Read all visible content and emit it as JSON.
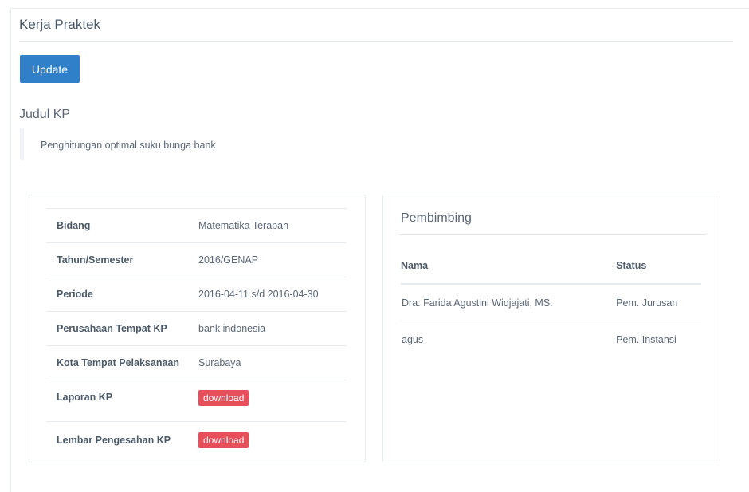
{
  "page": {
    "title": "Kerja Praktek",
    "update_label": "Update"
  },
  "judul": {
    "heading": "Judul KP",
    "text": "Penghitungan optimal suku bunga bank"
  },
  "info": {
    "rows": [
      {
        "label": "Bidang",
        "value": "Matematika Terapan"
      },
      {
        "label": "Tahun/Semester",
        "value": "2016/GENAP"
      },
      {
        "label": "Periode",
        "value": "2016-04-11 s/d 2016-04-30"
      },
      {
        "label": "Perusahaan Tempat KP",
        "value": "bank indonesia"
      },
      {
        "label": "Kota Tempat Pelaksanaan",
        "value": "Surabaya"
      },
      {
        "label": "Laporan KP",
        "value": "download"
      },
      {
        "label": "Lembar Pengesahan KP",
        "value": "download"
      }
    ]
  },
  "pembimbing": {
    "title": "Pembimbing",
    "columns": [
      "Nama",
      "Status"
    ],
    "rows": [
      {
        "nama": "Dra. Farida Agustini Widjajati, MS.",
        "status": "Pem. Jurusan"
      },
      {
        "nama": "agus",
        "status": "Pem. Instansi"
      }
    ]
  },
  "colors": {
    "primary": "#2f80c8",
    "danger": "#e7505a"
  }
}
